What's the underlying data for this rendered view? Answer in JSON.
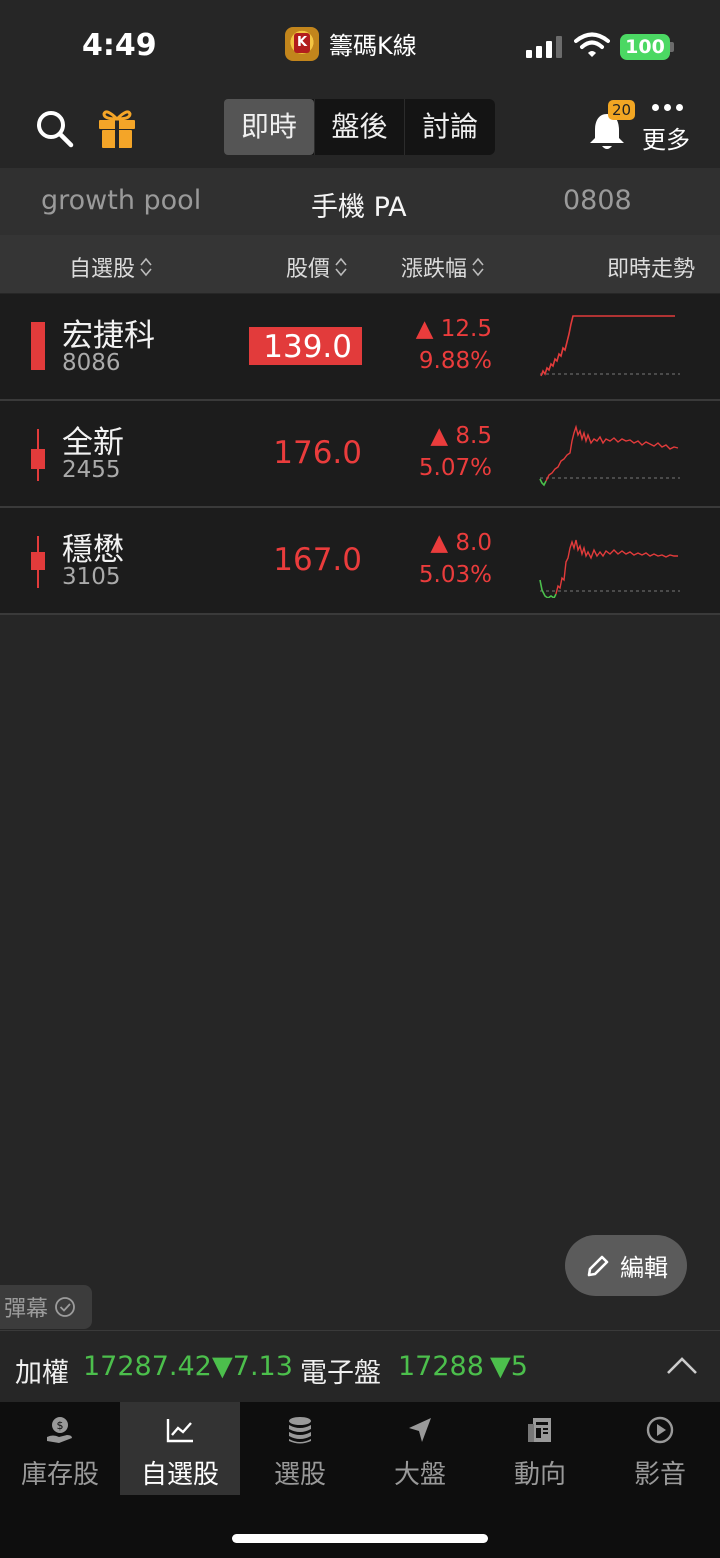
{
  "status_bar": {
    "time": "4:49",
    "app_name": "籌碼K線",
    "app_logo_letter": "K",
    "battery": "100"
  },
  "nav": {
    "tabs": [
      {
        "label": "即時",
        "active": true
      },
      {
        "label": "盤後",
        "active": false
      },
      {
        "label": "討論",
        "active": false
      }
    ],
    "notification_count": "20",
    "more_label": "更多"
  },
  "groups": [
    {
      "label": "growth pool",
      "active": false
    },
    {
      "label": "手機 PA",
      "active": true
    },
    {
      "label": "0808",
      "active": false
    }
  ],
  "columns": {
    "name": "自選股",
    "price": "股價",
    "change": "漲跌幅",
    "trend": "即時走勢"
  },
  "stocks": [
    {
      "name": "宏捷科",
      "code": "8086",
      "price": "139.0",
      "change": "▲ 12.5",
      "percent": "9.88%",
      "highlight": true
    },
    {
      "name": "全新",
      "code": "2455",
      "price": "176.0",
      "change": "▲ 8.5",
      "percent": "5.07%",
      "highlight": false
    },
    {
      "name": "穩懋",
      "code": "3105",
      "price": "167.0",
      "change": "▲ 8.0",
      "percent": "5.03%",
      "highlight": false
    }
  ],
  "edit_label": "編輯",
  "danmaku_label": "彈幕",
  "ticker": {
    "index1_name": "加權",
    "index1_value": "17287.42",
    "index1_change": "▼7.13",
    "index2_name": "電子盤",
    "index2_value": "17288",
    "index2_change": "▼5"
  },
  "tabbar": [
    {
      "label": "庫存股",
      "icon": "coin-hand-icon",
      "active": false
    },
    {
      "label": "自選股",
      "icon": "chart-line-icon",
      "active": true
    },
    {
      "label": "選股",
      "icon": "database-icon",
      "active": false
    },
    {
      "label": "大盤",
      "icon": "navigation-arrow-icon",
      "active": false
    },
    {
      "label": "動向",
      "icon": "newspaper-icon",
      "active": false
    },
    {
      "label": "影音",
      "icon": "play-circle-icon",
      "active": false
    }
  ],
  "colors": {
    "up": "#ea3c3c",
    "down": "#4cbf4c",
    "background": "#262626",
    "badge": "#f2a623"
  }
}
